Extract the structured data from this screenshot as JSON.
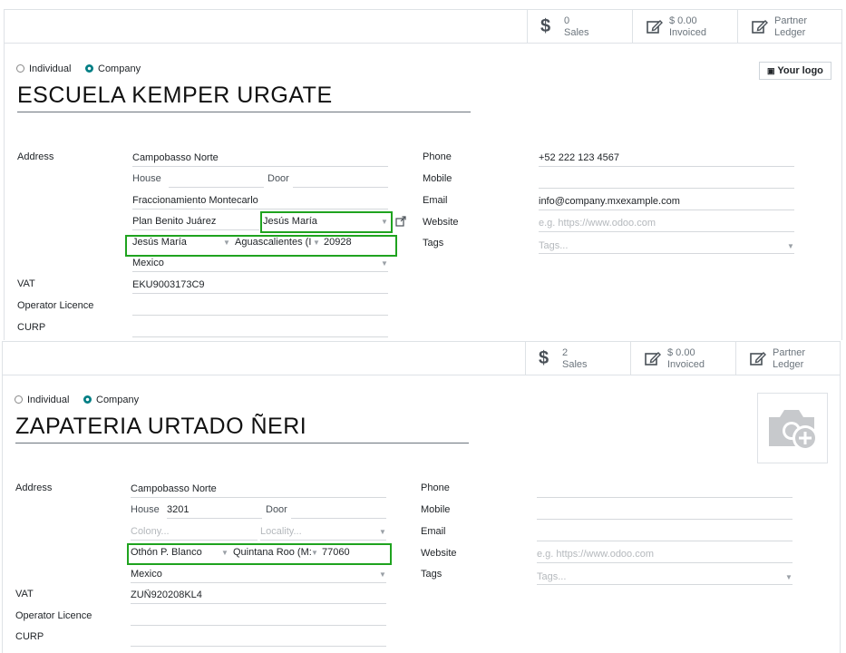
{
  "records": [
    {
      "stats": [
        {
          "value": "0",
          "label": "Sales",
          "icon": "dollar-icon"
        },
        {
          "value": "$ 0.00",
          "label": "Invoiced",
          "icon": "edit-icon"
        },
        {
          "value": "Partner",
          "label": "Ledger",
          "icon": "edit-icon"
        }
      ],
      "type_individual": "Individual",
      "type_company": "Company",
      "name": "ESCUELA KEMPER URGATE",
      "logo_button": "Your logo",
      "labels": {
        "address": "Address",
        "vat": "VAT",
        "operator": "Operator Licence",
        "curp": "CURP",
        "phone": "Phone",
        "mobile": "Mobile",
        "email": "Email",
        "website": "Website",
        "tags": "Tags"
      },
      "street": "Campobasso Norte",
      "house_label": "House",
      "house": "",
      "door_label": "Door",
      "door": "",
      "colony": "Fraccionamiento Montecarlo",
      "locality": "Plan Benito Juárez",
      "city_dropdown": "Jesús María",
      "city": "Jesús María",
      "state": "Aguascalientes (I",
      "zip": "20928",
      "country": "Mexico",
      "vat": "EKU9003173C9",
      "phone": "+52 222 123 4567",
      "email": "info@company.mxexample.com",
      "website_placeholder": "e.g. https://www.odoo.com",
      "tags_placeholder": "Tags..."
    },
    {
      "stats": [
        {
          "value": "2",
          "label": "Sales",
          "icon": "dollar-icon"
        },
        {
          "value": "$ 0.00",
          "label": "Invoiced",
          "icon": "edit-icon"
        },
        {
          "value": "Partner",
          "label": "Ledger",
          "icon": "edit-icon"
        }
      ],
      "type_individual": "Individual",
      "type_company": "Company",
      "name": "ZAPATERIA URTADO ÑERI",
      "labels": {
        "address": "Address",
        "vat": "VAT",
        "operator": "Operator Licence",
        "curp": "CURP",
        "phone": "Phone",
        "mobile": "Mobile",
        "email": "Email",
        "website": "Website",
        "tags": "Tags"
      },
      "street": "Campobasso Norte",
      "house_label": "House",
      "house": "3201",
      "door_label": "Door",
      "colony_placeholder": "Colony...",
      "locality_placeholder": "Locality...",
      "city": "Othón P. Blanco",
      "state": "Quintana Roo (M:",
      "zip": "77060",
      "country": "Mexico",
      "vat": "ZUÑ920208KL4",
      "website_placeholder": "e.g. https://www.odoo.com",
      "tags_placeholder": "Tags..."
    }
  ],
  "colors": {
    "accent": "#017e84",
    "highlight": "#1fa31f"
  }
}
